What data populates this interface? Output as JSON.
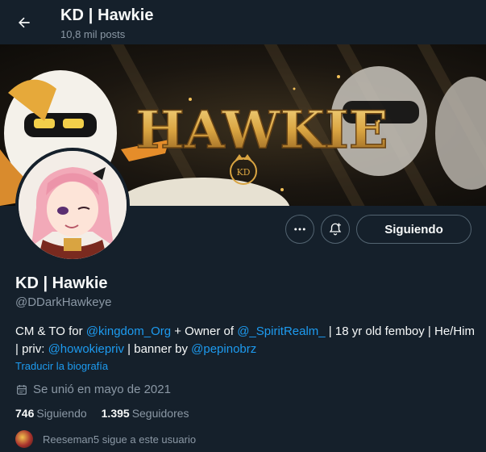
{
  "header": {
    "title": "KD | Hawkie",
    "posts": "10,8 mil posts"
  },
  "banner": {
    "text": "HAWKIE",
    "emblem_text": "KD"
  },
  "actions": {
    "follow_label": "Siguiendo"
  },
  "profile": {
    "name": "KD | Hawkie",
    "handle": "@DDarkHawkeye",
    "bio": {
      "t1": "CM & TO for ",
      "m1": "@kingdom_Org",
      "t2": " + Owner of ",
      "m2": "@_SpiritRealm_",
      "t3": " | 18 yr old femboy | He/Him | priv: ",
      "m3": "@howokiepriv",
      "t4": " | banner by ",
      "m4": "@pepinobrz"
    },
    "translate": "Traducir la biografía",
    "joined": "Se unió en mayo de 2021",
    "following_count": "746",
    "following_label": "Siguiendo",
    "followers_count": "1.395",
    "followers_label": "Seguidores",
    "followed_by": "Reeseman5 sigue a este usuario"
  },
  "colors": {
    "background": "#15202b",
    "accent": "#1d9bf0",
    "secondary_text": "#8b98a5",
    "border": "#536471",
    "banner_gold": "#d9a441"
  },
  "icons": {
    "back": "arrow-left-icon",
    "more": "more-dots-icon",
    "notify": "bell-plus-icon",
    "calendar": "calendar-icon"
  }
}
